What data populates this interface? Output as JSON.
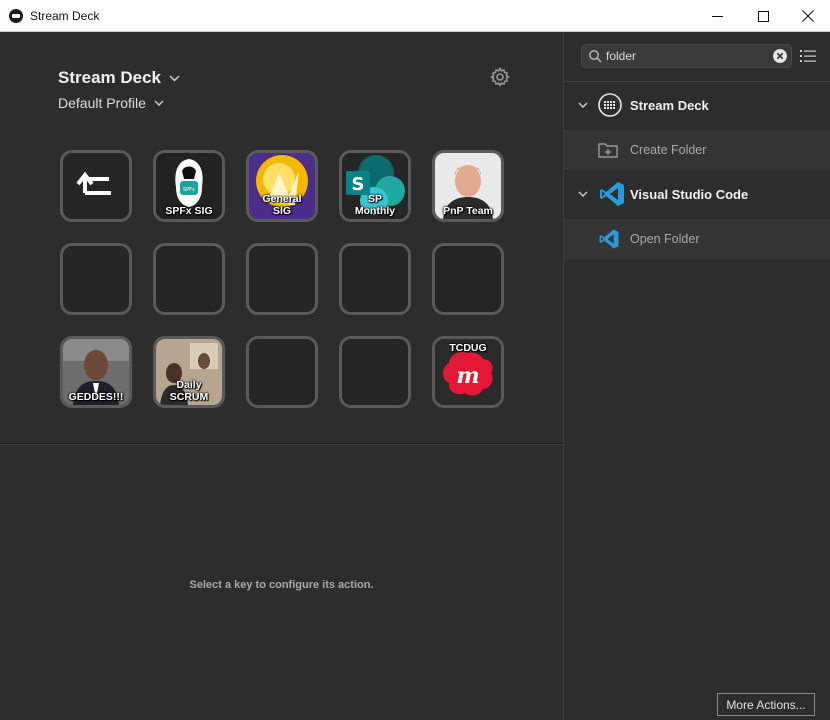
{
  "window": {
    "title": "Stream Deck"
  },
  "deck": {
    "device_name": "Stream Deck",
    "profile_name": "Default Profile",
    "keys": [
      {
        "label": ""
      },
      {
        "label": "SPFx SIG"
      },
      {
        "label": "General\nSIG"
      },
      {
        "label": "SP\nMonthly"
      },
      {
        "label": "PnP Team"
      },
      {
        "label": ""
      },
      {
        "label": ""
      },
      {
        "label": ""
      },
      {
        "label": ""
      },
      {
        "label": ""
      },
      {
        "label": "GEDDES!!!"
      },
      {
        "label": "Daily\nSCRUM"
      },
      {
        "label": ""
      },
      {
        "label": ""
      },
      {
        "label": "TCDUG"
      }
    ],
    "hint": "Select a key to configure its action."
  },
  "actions_panel": {
    "search_value": "folder",
    "categories": [
      {
        "label": "Stream Deck",
        "actions": [
          {
            "label": "Create Folder"
          }
        ]
      },
      {
        "label": "Visual Studio Code",
        "actions": [
          {
            "label": "Open Folder"
          }
        ]
      }
    ],
    "more_actions_label": "More Actions..."
  },
  "colors": {
    "background": "#2d2d2d",
    "key_border": "#5a5a5a",
    "vscode_blue": "#2a9bd8",
    "meetup_red": "#e51937"
  }
}
